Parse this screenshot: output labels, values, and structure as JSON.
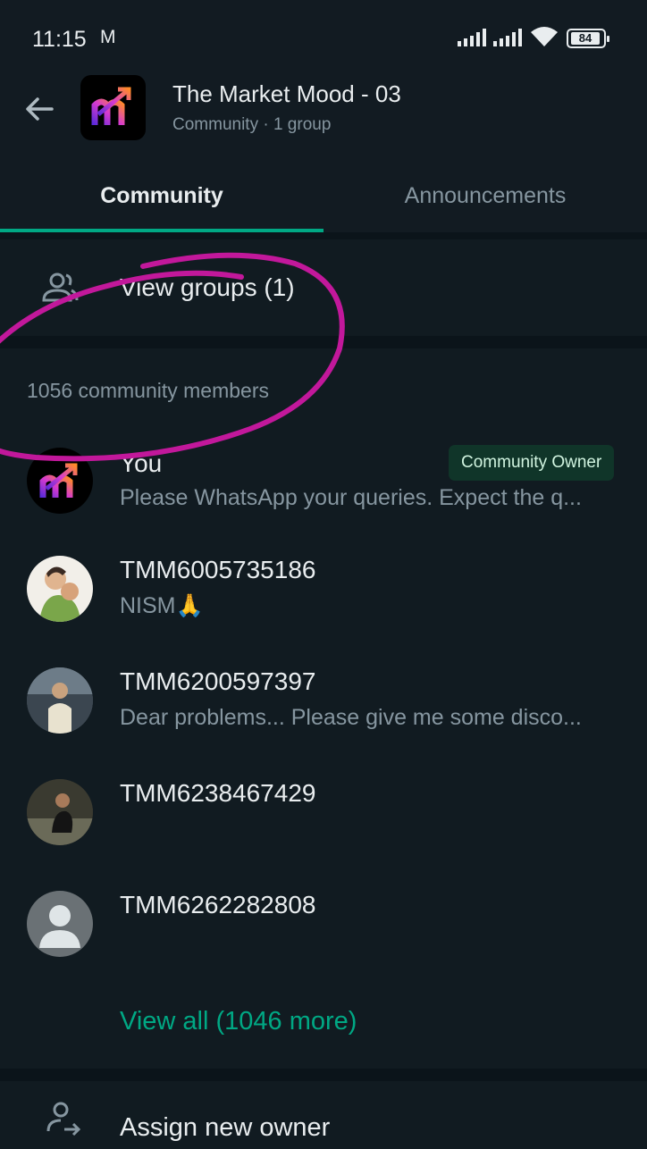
{
  "status_bar": {
    "time": "11:15",
    "battery": "84",
    "icons": [
      "gmail-icon",
      "signal-icon",
      "signal-icon",
      "wifi-icon",
      "battery-icon"
    ]
  },
  "header": {
    "title": "The Market Mood - 03",
    "subtitle": "Community · 1 group"
  },
  "tabs": [
    {
      "label": "Community",
      "active": true
    },
    {
      "label": "Announcements",
      "active": false
    }
  ],
  "view_groups": {
    "label": "View groups (1)"
  },
  "members": {
    "count_label": "1056 community members",
    "owner_badge": "Community Owner",
    "items": [
      {
        "name": "You",
        "status": "Please WhatsApp your queries. Expect the q..."
      },
      {
        "name": "TMM6005735186",
        "status": "NISM🙏"
      },
      {
        "name": "TMM6200597397",
        "status": "Dear problems... Please give me some disco..."
      },
      {
        "name": "TMM6238467429",
        "status": ""
      },
      {
        "name": "TMM6262282808",
        "status": ""
      }
    ],
    "view_all": "View all (1046 more)"
  },
  "assign_owner": {
    "label": "Assign new owner"
  },
  "colors": {
    "background": "#0b141a",
    "panel": "#111b21",
    "accent": "#00a884",
    "annotation": "#c2189b"
  }
}
